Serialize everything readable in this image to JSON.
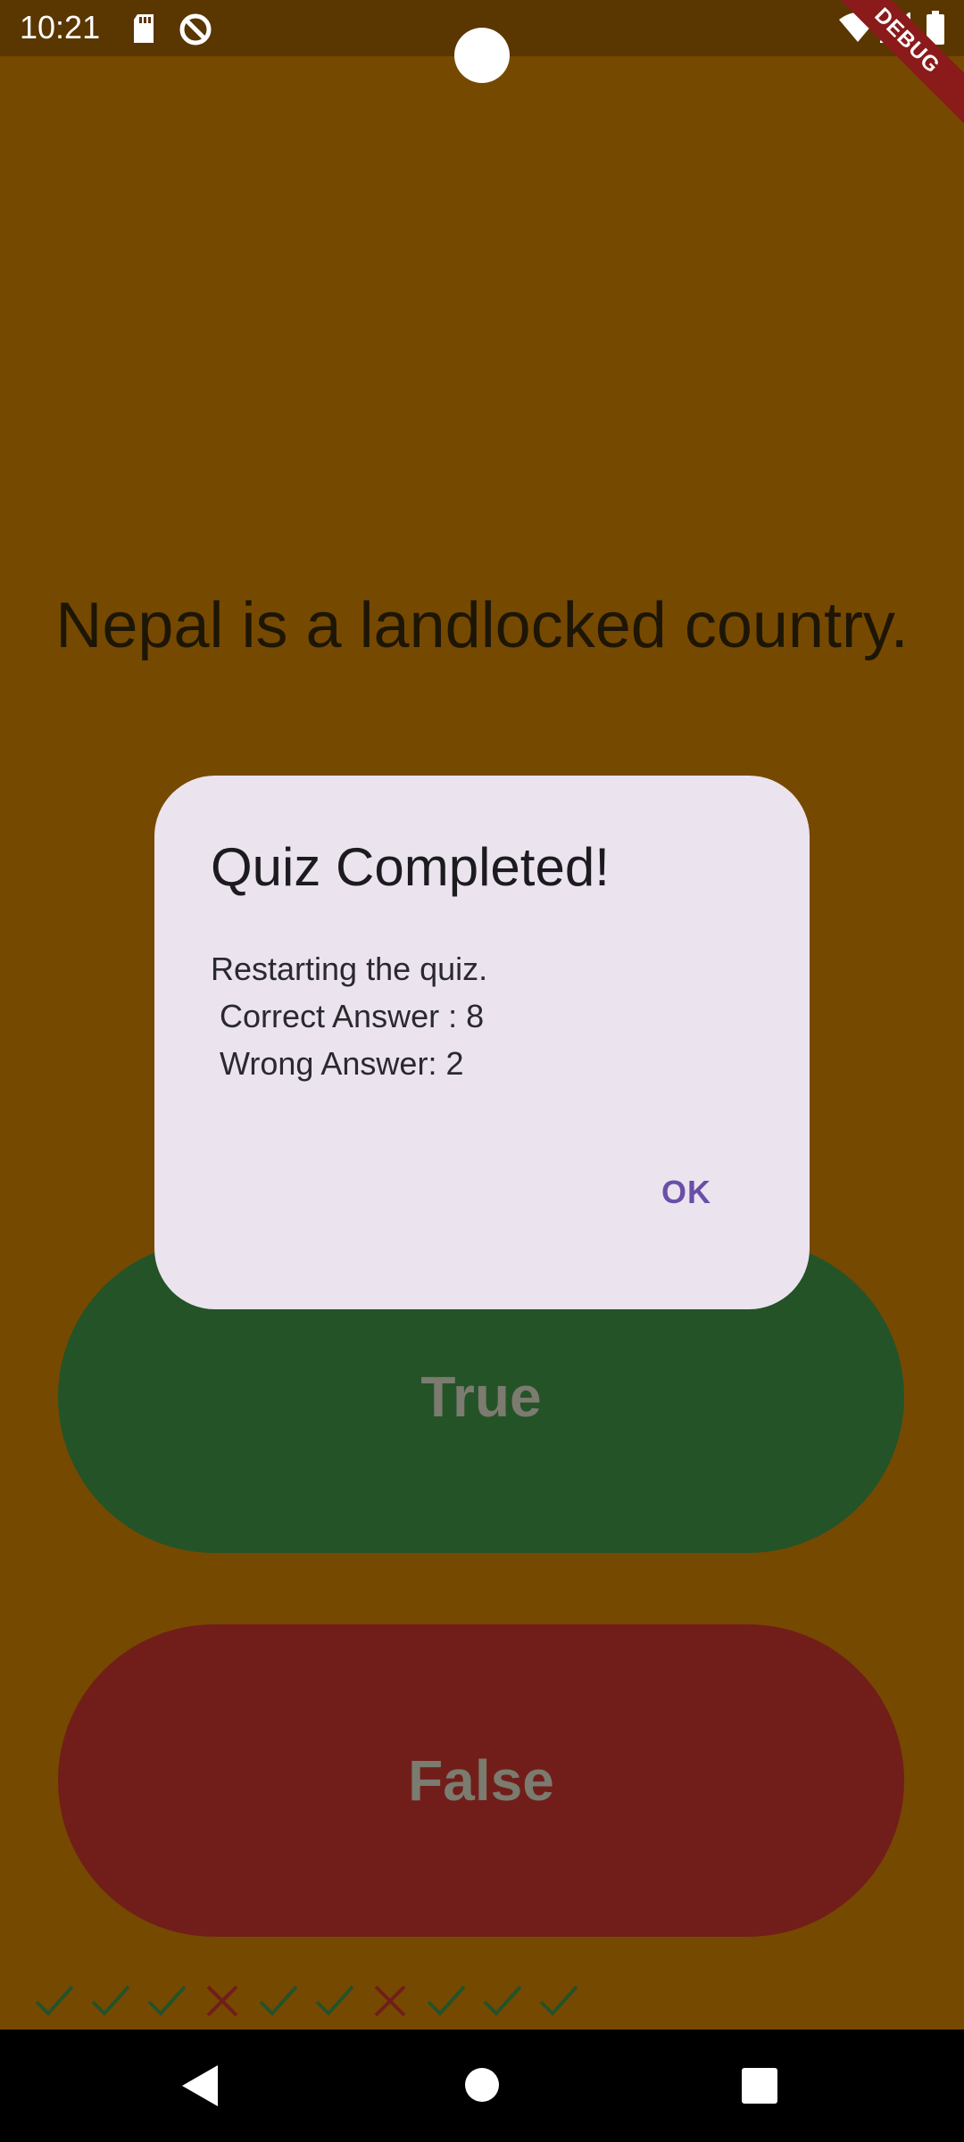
{
  "status_bar": {
    "time": "10:21",
    "icons": [
      "sd-card-icon",
      "do-not-disturb-icon",
      "wifi-icon",
      "cellular-signal-icon",
      "battery-icon"
    ]
  },
  "debug_banner": {
    "label": "DEBUG",
    "color": "#8b1a1a"
  },
  "colors": {
    "background": "#764901",
    "true_button": "#245328",
    "false_button": "#711e1a",
    "dialog_background": "#ebe4ee",
    "dialog_action": "#6a4fa8",
    "correct_mark": "#245328",
    "wrong_mark": "#711e1a"
  },
  "question": {
    "text": "Nepal is a landlocked country."
  },
  "buttons": {
    "true_label": "True",
    "false_label": "False"
  },
  "dialog": {
    "title": "Quiz Completed!",
    "message_lines": [
      "Restarting the quiz.",
      " Correct Answer : 8",
      " Wrong Answer: 2"
    ],
    "ok_label": "OK"
  },
  "score_keeper": {
    "marks": [
      "correct",
      "correct",
      "correct",
      "wrong",
      "correct",
      "correct",
      "wrong",
      "correct",
      "correct",
      "correct"
    ]
  },
  "nav_bar": {
    "buttons": [
      "back-icon",
      "home-icon",
      "recents-icon"
    ]
  }
}
